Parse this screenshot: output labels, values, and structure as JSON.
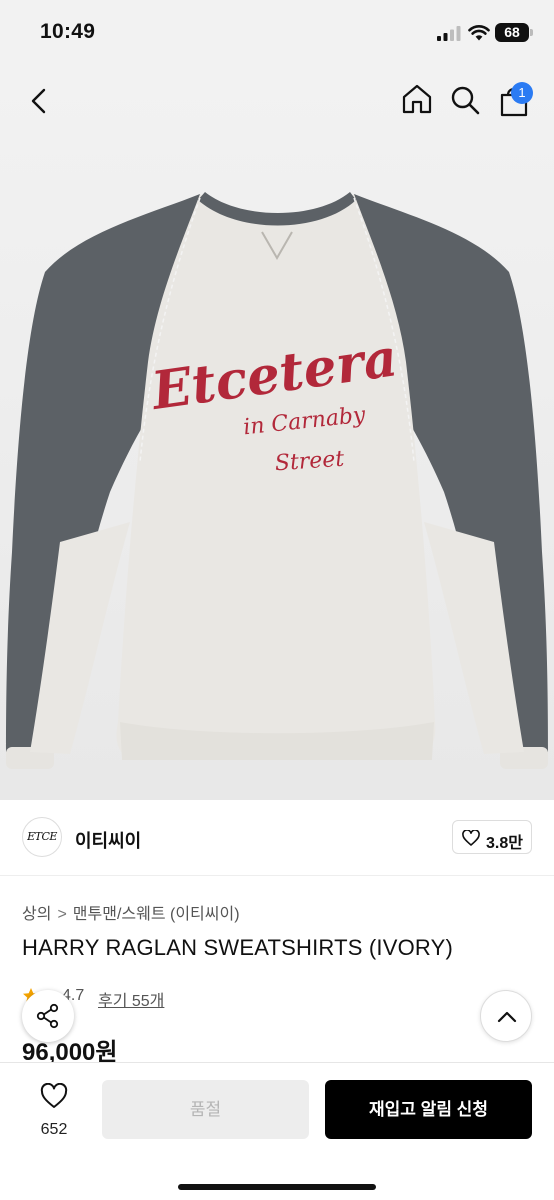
{
  "status": {
    "time": "10:49",
    "battery": "68"
  },
  "nav": {
    "cart_badge": "1"
  },
  "product_image": {
    "graphic_text": [
      "Etcetera",
      "in Carnaby",
      "Street"
    ],
    "colors": {
      "body": "#e9e7e3",
      "sleeve": "#5c6166",
      "embroidery": "#b2283a"
    }
  },
  "brand": {
    "logo_text": "ETCE",
    "name": "이티씨이",
    "likes": "3.8만"
  },
  "product": {
    "breadcrumb": [
      "상의",
      "맨투맨/스웨트 (이티씨이)"
    ],
    "breadcrumb_separator": ">",
    "title": "HARRY RAGLAN SWEATSHIRTS (IVORY)",
    "rating": "4.7",
    "reviews": "후기 55개",
    "price": "96,000원"
  },
  "bottom_bar": {
    "wish_count": "652",
    "soldout_label": "품절",
    "restock_label": "재입고 알림 신청"
  },
  "colors": {
    "accent": "#2b7bf3",
    "primary_button": "#000000",
    "disabled_button": "#ededed",
    "star": "#f4a300"
  }
}
